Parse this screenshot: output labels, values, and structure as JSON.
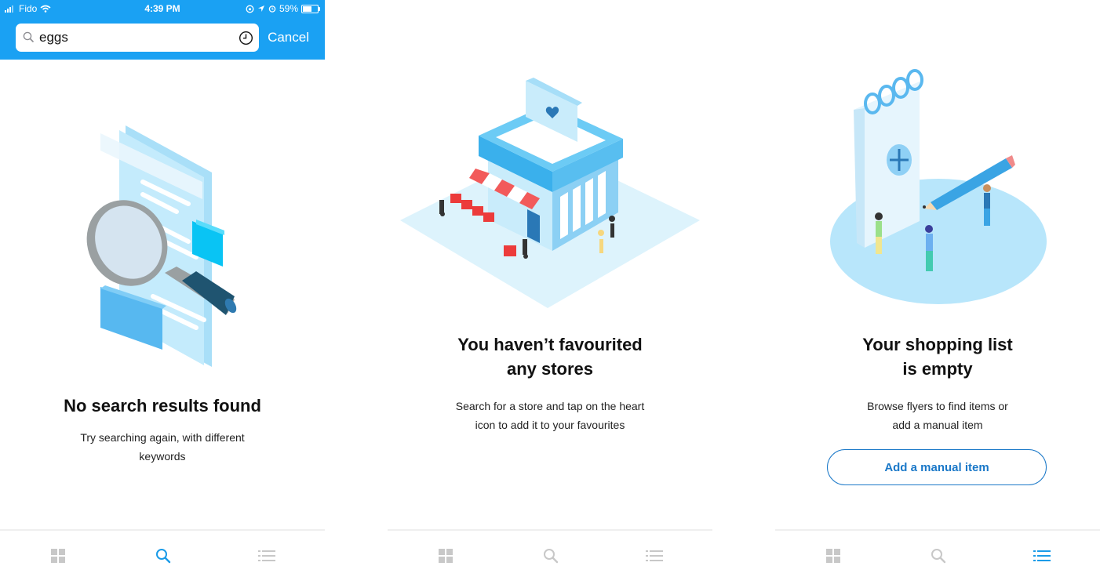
{
  "status_bar": {
    "carrier": "Fido",
    "time": "4:39 PM",
    "battery": "59%",
    "battery_level": 0.59
  },
  "search": {
    "query": "eggs",
    "cancel_label": "Cancel"
  },
  "screens": [
    {
      "title": "No search results found",
      "body_lines": [
        "Try searching again, with different",
        "keywords"
      ],
      "active_tab": "search"
    },
    {
      "title_lines": [
        "You haven’t favourited",
        "any stores"
      ],
      "body_lines": [
        "Search for a store and tap on the heart",
        "icon to add it to your favourites"
      ],
      "active_tab": "none"
    },
    {
      "title_lines": [
        "Your shopping list",
        "is empty"
      ],
      "body_lines": [
        "Browse flyers to find items or",
        "add a manual item"
      ],
      "button_label": "Add a manual item",
      "active_tab": "list"
    }
  ],
  "tabs": [
    {
      "icon": "grid-icon"
    },
    {
      "icon": "search-icon"
    },
    {
      "icon": "list-icon"
    }
  ],
  "colors": {
    "brand_blue": "#1aa1f3",
    "active_tab": "#1a9be8",
    "inactive_tab": "#c8c8c8",
    "button_blue": "#1a78c8"
  }
}
